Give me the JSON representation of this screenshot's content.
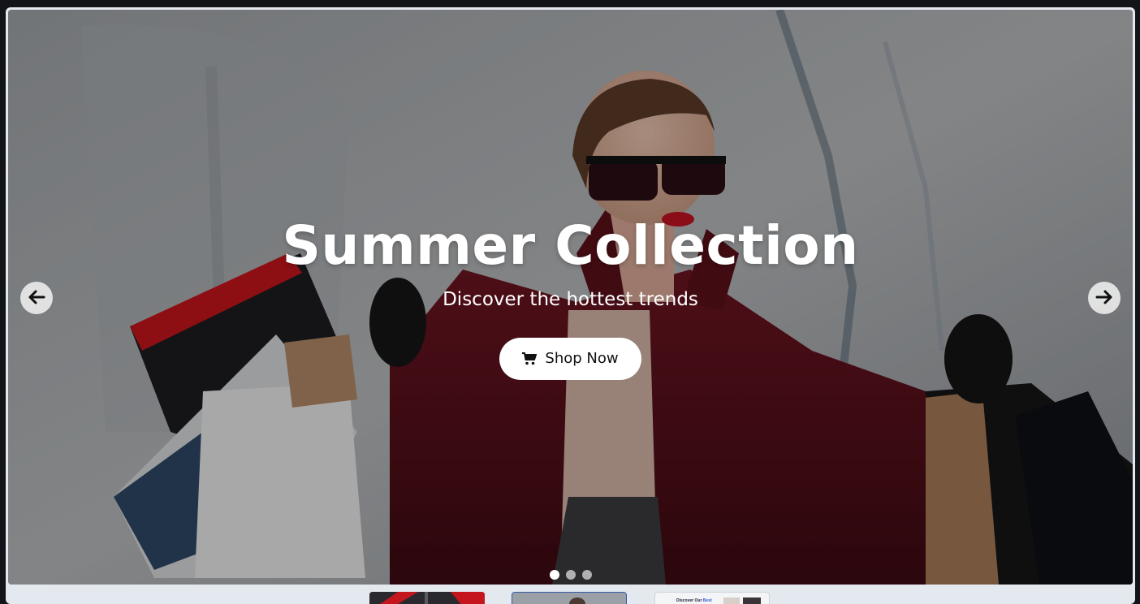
{
  "hero": {
    "title": "Summer Collection",
    "subtitle": "Discover the hottest trends",
    "cta_label": "Shop Now",
    "cta_icon": "cart-icon"
  },
  "carousel": {
    "prev_icon": "arrow-left-icon",
    "next_icon": "arrow-right-icon",
    "total_slides": 3,
    "active_index": 0
  },
  "thumbnails": [
    {
      "label": ""
    },
    {
      "label": ""
    },
    {
      "label_prefix": "Discover Our",
      "label_highlight": "Best"
    }
  ],
  "colors": {
    "page_background": "#121417",
    "frame_background": "#e4e8ef",
    "button_background": "#ffffff",
    "text_on_image": "#ffffff",
    "coat_red": "#5a1018"
  }
}
